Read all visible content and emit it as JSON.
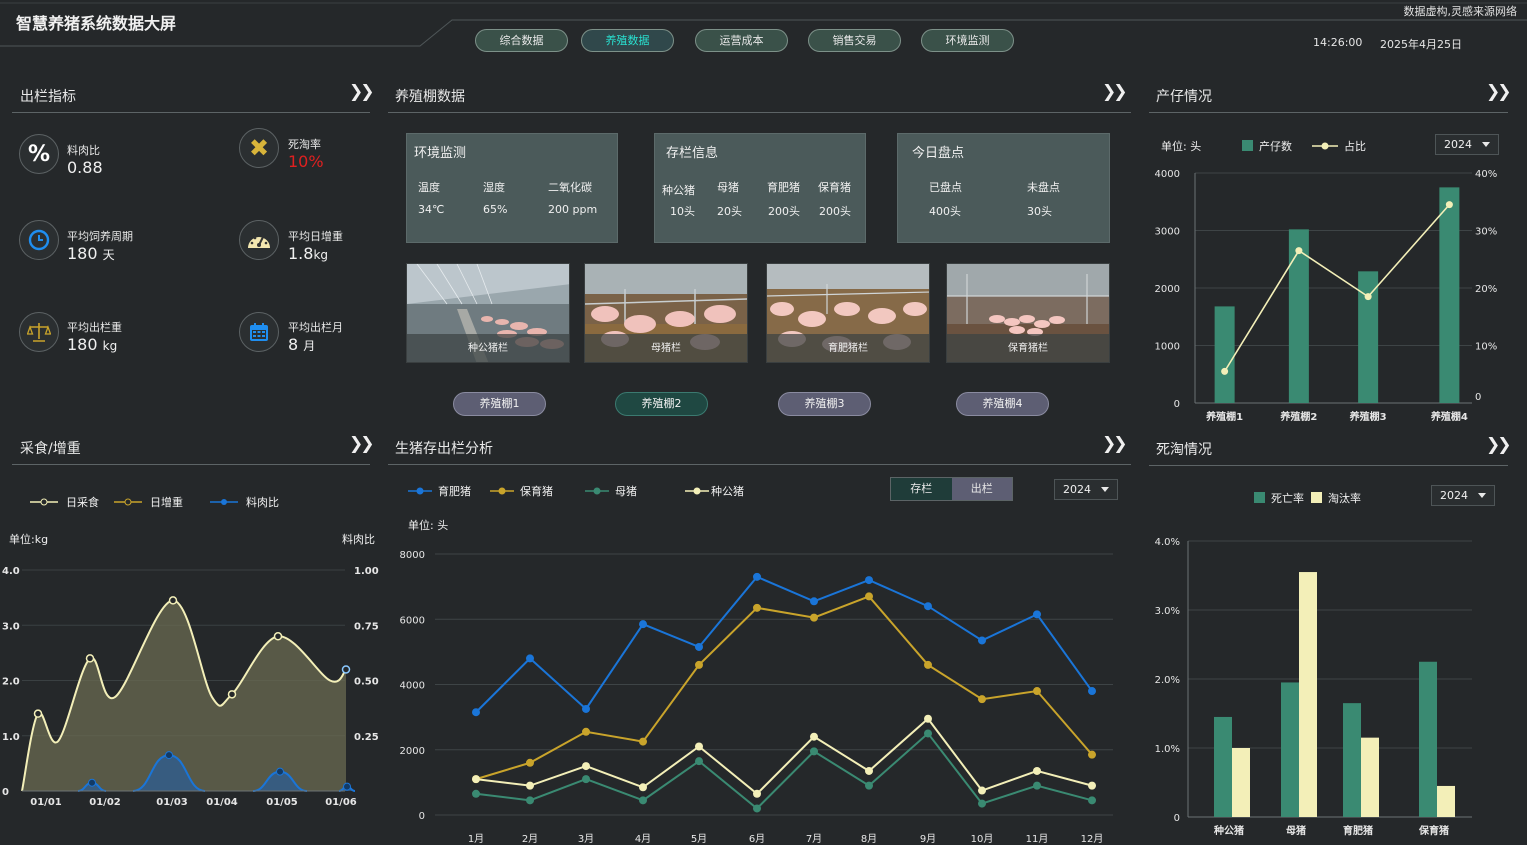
{
  "header": {
    "title": "智慧养猪系统数据大屏",
    "disclaimer": "数据虚构,灵感来源网络",
    "time": "14:26:00",
    "date": "2025年4月25日",
    "nav": [
      {
        "label": "综合数据"
      },
      {
        "label": "养殖数据"
      },
      {
        "label": "运营成本"
      },
      {
        "label": "销售交易"
      },
      {
        "label": "环境监测"
      }
    ],
    "active_nav": 1
  },
  "colors": {
    "teal": "#3a8a72",
    "cream": "#f3efb8",
    "blue": "#1a75d8",
    "gold": "#c9a42b",
    "green": "#3a8a72",
    "active_nav_text": "#29e0d0",
    "red": "#e02020"
  },
  "outbound": {
    "title": "出栏指标",
    "more_icon": "double-chevron-right-icon",
    "items": [
      {
        "icon": "percent-icon",
        "label": "料肉比",
        "value": "0.88",
        "unit": ""
      },
      {
        "icon": "cross-icon",
        "label": "死淘率",
        "value": "10%",
        "unit": ""
      },
      {
        "icon": "clock-icon",
        "label": "平均饲养周期",
        "value": "180",
        "unit": "天"
      },
      {
        "icon": "gauge-icon",
        "label": "平均日增重",
        "value": "1.8",
        "unit": "kg"
      },
      {
        "icon": "scale-icon",
        "label": "平均出栏重",
        "value": "180",
        "unit": "kg"
      },
      {
        "icon": "calendar-icon",
        "label": "平均出栏月",
        "value": "8",
        "unit": "月"
      }
    ]
  },
  "barn": {
    "title": "养殖棚数据",
    "env": {
      "title": "环境监测",
      "headers": [
        "温度",
        "湿度",
        "二氧化碳"
      ],
      "values": [
        "34℃",
        "65%",
        "200 ppm"
      ]
    },
    "stock": {
      "title": "存栏信息",
      "headers": [
        "种公猪",
        "母猪",
        "育肥猪",
        "保育猪"
      ],
      "values": [
        "10头",
        "20头",
        "200头",
        "200头"
      ]
    },
    "count": {
      "title": "今日盘点",
      "headers": [
        "已盘点",
        "未盘点"
      ],
      "values": [
        "400头",
        "30头"
      ]
    },
    "photos": [
      {
        "caption": "种公猪栏"
      },
      {
        "caption": "母猪栏"
      },
      {
        "caption": "育肥猪栏"
      },
      {
        "caption": "保育猪栏"
      }
    ],
    "pens": [
      {
        "label": "养殖棚1"
      },
      {
        "label": "养殖棚2"
      },
      {
        "label": "养殖棚3"
      },
      {
        "label": "养殖棚4"
      }
    ],
    "active_pen": 1
  },
  "farrowing": {
    "title": "产仔情况",
    "unit_label": "单位: 头",
    "year": "2024",
    "legend": [
      "产仔数",
      "占比"
    ]
  },
  "feed": {
    "title": "采食/增重",
    "legend": [
      "日采食",
      "日增重",
      "料肉比"
    ],
    "left_unit": "单位:kg",
    "right_unit": "料肉比"
  },
  "stock_analysis": {
    "title": "生猪存出栏分析",
    "unit_label": "单位: 头",
    "year": "2024",
    "toggle": [
      "存栏",
      "出栏"
    ],
    "toggle_active": 0,
    "legend": [
      "育肥猪",
      "保育猪",
      "母猪",
      "种公猪"
    ]
  },
  "mortality": {
    "title": "死淘情况",
    "year": "2024",
    "legend": [
      "死亡率",
      "淘汰率"
    ]
  },
  "chart_data": [
    {
      "type": "bar",
      "id": "farrowing",
      "categories": [
        "养殖棚1",
        "养殖棚2",
        "养殖棚3",
        "养殖棚4"
      ],
      "series": [
        {
          "name": "产仔数",
          "values": [
            1680,
            3020,
            2290,
            3750
          ],
          "axis": "left"
        },
        {
          "name": "占比",
          "type": "line",
          "values": [
            5.5,
            26.5,
            18.5,
            34.5
          ],
          "axis": "right"
        }
      ],
      "ylim": [
        0,
        4000
      ],
      "yticks": [
        0,
        1000,
        2000,
        3000,
        4000
      ],
      "y2lim": [
        0,
        40
      ],
      "y2ticks": [
        "",
        "10%",
        "20%",
        "30%",
        "40%"
      ],
      "y2tick_zero": "0"
    },
    {
      "type": "area",
      "id": "feed",
      "x": [
        "01/01",
        "01/02",
        "01/03",
        "01/04",
        "01/05",
        "01/06"
      ],
      "series": [
        {
          "name": "日采食",
          "values": [
            1.4,
            2.4,
            3.45,
            1.75,
            2.8,
            2.2
          ],
          "axis": "left"
        },
        {
          "name": "日增重",
          "values": [
            0.0,
            0.15,
            0.65,
            0.0,
            0.35,
            0.08
          ],
          "axis": "left"
        },
        {
          "name": "料肉比",
          "values": [
            0.0,
            0.04,
            0.16,
            0.0,
            0.09,
            0.02
          ],
          "axis": "right"
        }
      ],
      "ylim": [
        0,
        4
      ],
      "yticks": [
        "0",
        "1.0",
        "2.0",
        "3.0",
        "4.0"
      ],
      "y2lim": [
        0,
        1
      ],
      "y2ticks": [
        "",
        "0.25",
        "0.50",
        "0.75",
        "1.00"
      ]
    },
    {
      "type": "line",
      "id": "stock",
      "x": [
        "1月",
        "2月",
        "3月",
        "4月",
        "5月",
        "6月",
        "7月",
        "8月",
        "9月",
        "10月",
        "11月",
        "12月"
      ],
      "series": [
        {
          "name": "育肥猪",
          "values": [
            3150,
            4800,
            3250,
            5850,
            5150,
            7300,
            6550,
            7200,
            6400,
            5350,
            6150,
            3800
          ]
        },
        {
          "name": "保育猪",
          "values": [
            1100,
            1600,
            2550,
            2250,
            4600,
            6350,
            6050,
            6700,
            4600,
            3550,
            3800,
            1850
          ]
        },
        {
          "name": "母猪",
          "values": [
            650,
            450,
            1100,
            450,
            1650,
            200,
            1950,
            900,
            2500,
            350,
            900,
            450
          ]
        },
        {
          "name": "种公猪",
          "values": [
            1100,
            900,
            1500,
            850,
            2100,
            650,
            2400,
            1350,
            2950,
            750,
            1350,
            900
          ]
        }
      ],
      "ylim": [
        0,
        8000
      ],
      "yticks": [
        0,
        2000,
        4000,
        6000,
        8000
      ]
    },
    {
      "type": "bar",
      "id": "mortality",
      "categories": [
        "种公猪",
        "母猪",
        "育肥猪",
        "保育猪"
      ],
      "series": [
        {
          "name": "死亡率",
          "values": [
            1.45,
            1.95,
            1.65,
            2.25
          ]
        },
        {
          "name": "淘汰率",
          "values": [
            1.0,
            3.55,
            1.15,
            0.45
          ]
        }
      ],
      "ylim": [
        0,
        4
      ],
      "yticks": [
        "0",
        "1.0%",
        "2.0%",
        "3.0%",
        "4.0%"
      ]
    }
  ]
}
